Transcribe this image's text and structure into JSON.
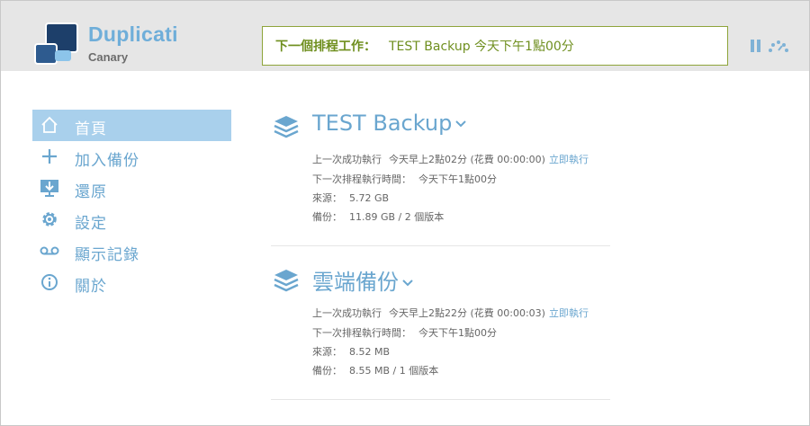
{
  "app": {
    "title": "Duplicati",
    "subtitle": "Canary"
  },
  "status": {
    "label": "下一個排程工作：",
    "value": "TEST Backup 今天下午1點00分"
  },
  "colors": {
    "accent": "#6aa6cf",
    "active_bg": "#a9d0ec",
    "status_green": "#6f8f1f",
    "header_bg": "#e6e6e6"
  },
  "sidebar": {
    "items": [
      {
        "label": "首頁",
        "icon": "home-icon"
      },
      {
        "label": "加入備份",
        "icon": "plus-icon"
      },
      {
        "label": "還原",
        "icon": "restore-icon"
      },
      {
        "label": "設定",
        "icon": "gear-icon"
      },
      {
        "label": "顯示記錄",
        "icon": "voicemail-icon"
      },
      {
        "label": "關於",
        "icon": "info-icon"
      }
    ]
  },
  "backups": [
    {
      "name": "TEST Backup",
      "last_run_label": "上一次成功執行",
      "last_run_value": "今天早上2點02分 (花費 00:00:00)",
      "run_now": "立即執行",
      "next_run_label": "下一次排程執行時間：",
      "next_run_value": "今天下午1點00分",
      "source_label": "來源：",
      "source_value": "5.72 GB",
      "backup_label": "備份：",
      "backup_value": "11.89 GB / 2 個版本"
    },
    {
      "name": "雲端備份",
      "last_run_label": "上一次成功執行",
      "last_run_value": "今天早上2點22分 (花費 00:00:03)",
      "run_now": "立即執行",
      "next_run_label": "下一次排程執行時間：",
      "next_run_value": "今天下午1點00分",
      "source_label": "來源：",
      "source_value": "8.52 MB",
      "backup_label": "備份：",
      "backup_value": "8.55 MB / 1 個版本"
    }
  ]
}
